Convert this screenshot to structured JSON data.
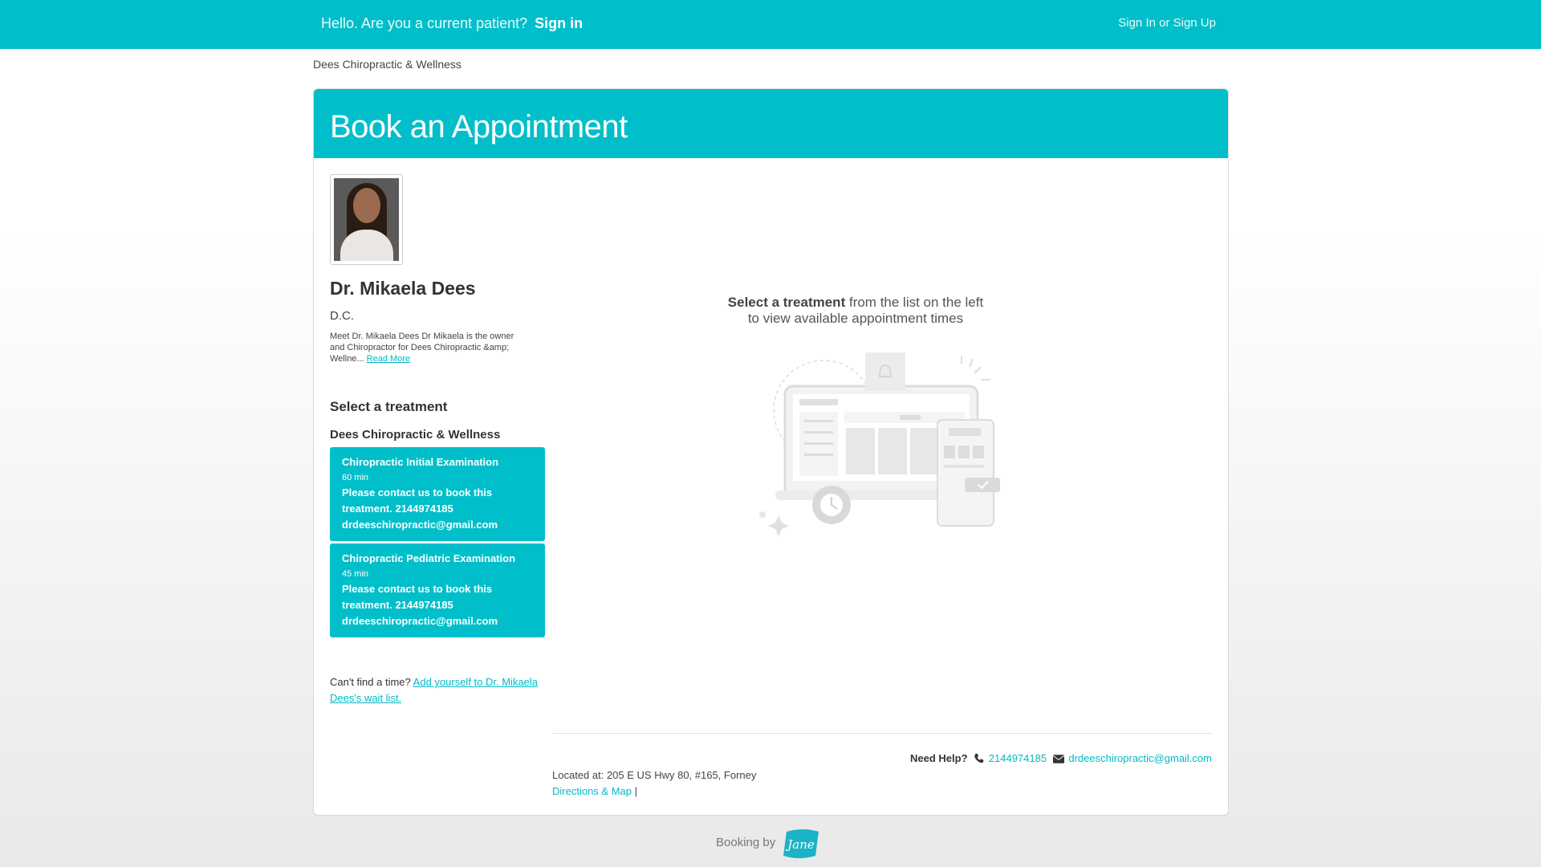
{
  "topbar": {
    "greeting": "Hello. Are you a current patient?",
    "signin_label": "Sign in",
    "auth_label": "Sign In or Sign Up"
  },
  "breadcrumb": "Dees Chiropractic & Wellness",
  "page_title": "Book an Appointment",
  "practitioner": {
    "name": "Dr. Mikaela Dees",
    "credentials": "D.C.",
    "bio": "Meet Dr. Mikaela Dees Dr Mikaela is the owner and Chiropractor for Dees Chiropractic &amp; Wellne...",
    "read_more": "Read More"
  },
  "treatments": {
    "title": "Select a treatment",
    "clinic": "Dees Chiropractic & Wellness",
    "items": [
      {
        "name": "Chiropractic Initial Examination",
        "duration": "60 min",
        "note": "Please contact us to book this treatment. 2144974185 drdeeschiropractic@gmail.com"
      },
      {
        "name": "Chiropractic Pediatric Examination",
        "duration": "45 min",
        "note": "Please contact us to book this treatment. 2144974185 drdeeschiropractic@gmail.com"
      }
    ]
  },
  "waitlist": {
    "prompt": "Can't find a time?",
    "link": "Add yourself to Dr. Mikaela Dees's wait list."
  },
  "empty_state": {
    "bold": "Select a treatment",
    "rest": "from the list on the left to view available appointment times"
  },
  "footer": {
    "location": "Located at: 205 E US Hwy 80, #165, Forney",
    "directions": "Directions & Map",
    "separator": "|",
    "help_label": "Need Help?",
    "phone": "2144974185",
    "email": "drdeeschiropractic@gmail.com"
  },
  "booking_by": "Booking by",
  "brand_logo_text": "Jane",
  "colors": {
    "accent": "#00bfca",
    "link": "#00bac7"
  }
}
